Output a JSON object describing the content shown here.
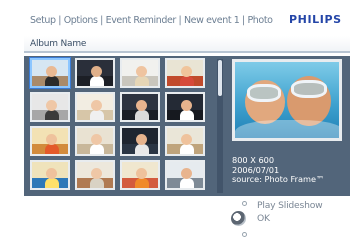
{
  "header": {
    "breadcrumb": "Setup | Options | Event Reminder | New event 1 | Photo",
    "brand": "PHILIPS"
  },
  "album": {
    "label": "Album Name"
  },
  "preview": {
    "resolution": "800 X 600",
    "date": "2006/07/01",
    "source": "source: Photo Frame™"
  },
  "controls": {
    "up_label": "Play Slideshow",
    "ok_label": "OK"
  },
  "colors": {
    "panel": "#52657a",
    "brand": "#2546a8",
    "selected_border": "#8cc6ff"
  },
  "thumbnails": [
    {
      "name": "photo-thumbnail",
      "sky": "#d6e6f2",
      "ground": "#a98a6a",
      "head": "#e9b993",
      "body": "#2b2b2b"
    },
    {
      "name": "photo-thumbnail",
      "sky": "#2a2f3a",
      "ground": "#1c1f26",
      "head": "#e0b08a",
      "body": "#ffffff"
    },
    {
      "name": "photo-thumbnail",
      "sky": "#f1f1ee",
      "ground": "#c9c6bd",
      "head": "#efc4a0",
      "body": "#e6d6b6"
    },
    {
      "name": "photo-thumbnail",
      "sky": "#e9e4d4",
      "ground": "#c14b2c",
      "head": "#f0c49b",
      "body": "#d64a3a"
    },
    {
      "name": "photo-thumbnail",
      "sky": "#e7e7e7",
      "ground": "#a7a7a7",
      "head": "#efc7a6",
      "body": "#3b3b3b"
    },
    {
      "name": "photo-thumbnail",
      "sky": "#f2ede2",
      "ground": "#d7c6a8",
      "head": "#efc7a6",
      "body": "#f0f0f0"
    },
    {
      "name": "photo-thumbnail",
      "sky": "#2c3340",
      "ground": "#1a1f27",
      "head": "#e8b48e",
      "body": "#dadada"
    },
    {
      "name": "photo-thumbnail",
      "sky": "#242a35",
      "ground": "#16191f",
      "head": "#e6b38d",
      "body": "#ffffff"
    },
    {
      "name": "photo-thumbnail",
      "sky": "#f3e2b4",
      "ground": "#d28b3c",
      "head": "#efc29c",
      "body": "#e35a2a"
    },
    {
      "name": "photo-thumbnail",
      "sky": "#e9e2d2",
      "ground": "#c8b79a",
      "head": "#efc7a6",
      "body": "#ffffff"
    },
    {
      "name": "photo-thumbnail",
      "sky": "#1e2530",
      "ground": "#2a3544",
      "head": "#e6b38d",
      "body": "#e8e8e8"
    },
    {
      "name": "photo-thumbnail",
      "sky": "#eae6d8",
      "ground": "#bfa47c",
      "head": "#efc29c",
      "body": "#ffffff"
    },
    {
      "name": "photo-thumbnail",
      "sky": "#efe3bb",
      "ground": "#2d78b8",
      "head": "#efc29c",
      "body": "#ffe06a"
    },
    {
      "name": "photo-thumbnail",
      "sky": "#ede8dc",
      "ground": "#b07a52",
      "head": "#efc7a6",
      "body": "#d9d2c4"
    },
    {
      "name": "photo-thumbnail",
      "sky": "#f0e7cf",
      "ground": "#d35b3e",
      "head": "#efc29c",
      "body": "#f08a2a"
    },
    {
      "name": "photo-thumbnail",
      "sky": "#e6ebef",
      "ground": "#7e8a96",
      "head": "#e8b48e",
      "body": "#ffffff"
    }
  ]
}
